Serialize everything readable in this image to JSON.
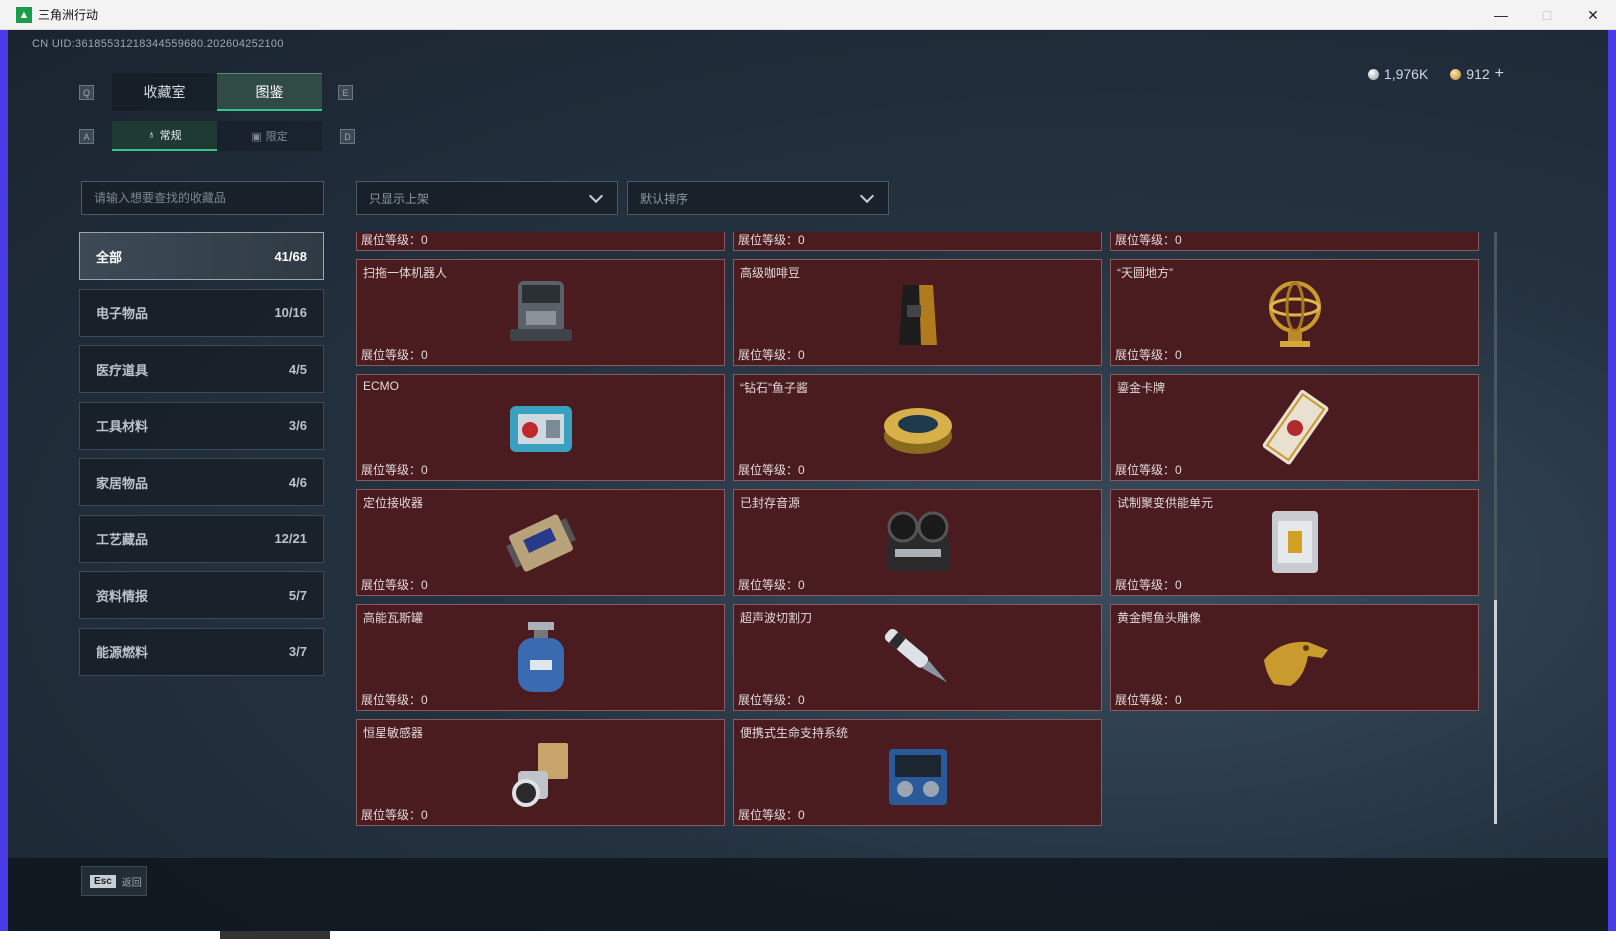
{
  "window": {
    "title": "三角洲行动",
    "minimize": "—",
    "maximize": "□",
    "close": "✕"
  },
  "uid": "CN UID:36185531218344559680.202604252100",
  "currency": {
    "silver": "1,976K",
    "gold": "912",
    "add": "+"
  },
  "keys": {
    "prev_tab": "Q",
    "next_tab": "E",
    "prev_sub": "A",
    "next_sub": "D"
  },
  "tabs": [
    {
      "label": "收藏室"
    },
    {
      "label": "图鉴"
    }
  ],
  "subtabs": [
    {
      "label": "常规"
    },
    {
      "label": "限定"
    }
  ],
  "search": {
    "placeholder": "请输入想要查找的收藏品"
  },
  "filters": {
    "display": "只显示上架",
    "sort": "默认排序"
  },
  "categories": [
    {
      "label": "全部",
      "count": "41/68"
    },
    {
      "label": "电子物品",
      "count": "10/16"
    },
    {
      "label": "医疗道具",
      "count": "4/5"
    },
    {
      "label": "工具材料",
      "count": "3/6"
    },
    {
      "label": "家居物品",
      "count": "4/6"
    },
    {
      "label": "工艺藏品",
      "count": "12/21"
    },
    {
      "label": "资料情报",
      "count": "5/7"
    },
    {
      "label": "能源燃料",
      "count": "3/7"
    }
  ],
  "level_label": "展位等级：0",
  "items": [
    {
      "name": "",
      "icon": "partial-item-icon"
    },
    {
      "name": "",
      "icon": "partial-item-icon"
    },
    {
      "name": "",
      "icon": "partial-item-icon"
    },
    {
      "name": "扫拖一体机器人",
      "icon": "robot-vacuum-icon"
    },
    {
      "name": "高级咖啡豆",
      "icon": "coffee-bag-icon"
    },
    {
      "name": "“天圆地方”",
      "icon": "armillary-sphere-icon"
    },
    {
      "name": "ECMO",
      "icon": "ecmo-machine-icon"
    },
    {
      "name": "“钻石”鱼子酱",
      "icon": "caviar-tin-icon"
    },
    {
      "name": "鎏金卡牌",
      "icon": "gilded-card-icon"
    },
    {
      "name": "定位接收器",
      "icon": "gps-receiver-icon"
    },
    {
      "name": "已封存音源",
      "icon": "tape-recorder-icon"
    },
    {
      "name": "试制聚变供能单元",
      "icon": "fusion-cell-icon"
    },
    {
      "name": "高能瓦斯罐",
      "icon": "gas-cylinder-icon"
    },
    {
      "name": "超声波切割刀",
      "icon": "ultrasonic-cutter-icon"
    },
    {
      "name": "黄金鳄鱼头雕像",
      "icon": "gold-crocodile-icon"
    },
    {
      "name": "恒星敏感器",
      "icon": "star-sensor-icon"
    },
    {
      "name": "便携式生命支持系统",
      "icon": "life-support-icon"
    }
  ],
  "bottom": {
    "esc_key": "Esc",
    "esc_label": "返回"
  }
}
